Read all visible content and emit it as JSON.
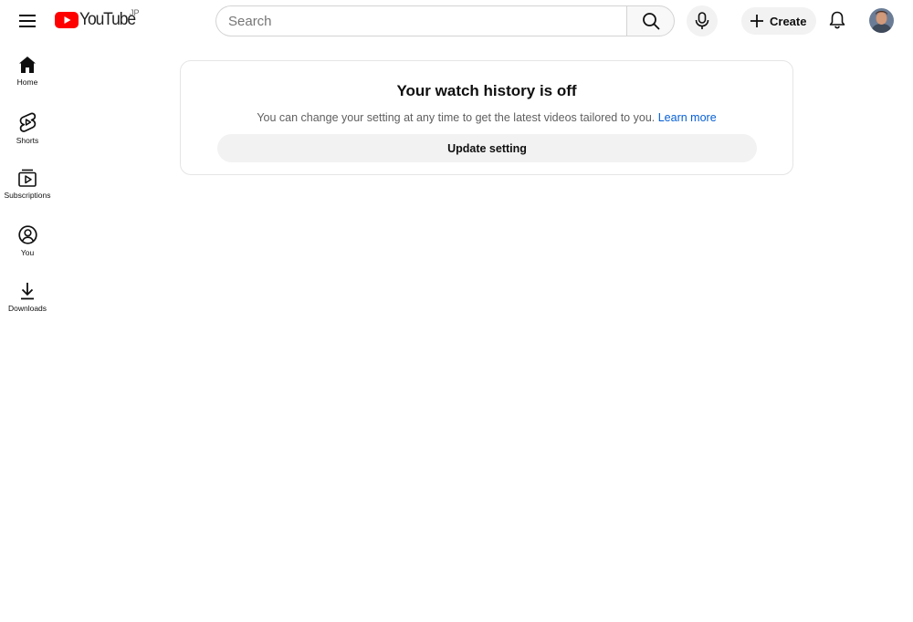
{
  "masthead": {
    "logo_text": "YouTube",
    "country_code": "JP",
    "search": {
      "placeholder": "Search",
      "value": ""
    },
    "create_label": "Create"
  },
  "sidebar": {
    "items": [
      {
        "label": "Home",
        "icon": "home-icon"
      },
      {
        "label": "Shorts",
        "icon": "shorts-icon"
      },
      {
        "label": "Subscriptions",
        "icon": "subscriptions-icon"
      },
      {
        "label": "You",
        "icon": "you-icon"
      },
      {
        "label": "Downloads",
        "icon": "downloads-icon"
      }
    ]
  },
  "main": {
    "title": "Your watch history is off",
    "description": "You can change your setting at any time to get the latest videos tailored to you.",
    "learn_more": "Learn more",
    "update_button": "Update setting"
  },
  "colors": {
    "brand_red": "#ff0000",
    "link_blue": "#065fd4",
    "button_bg": "#f2f2f2",
    "text_primary": "#0f0f0f",
    "text_secondary": "#606060"
  }
}
